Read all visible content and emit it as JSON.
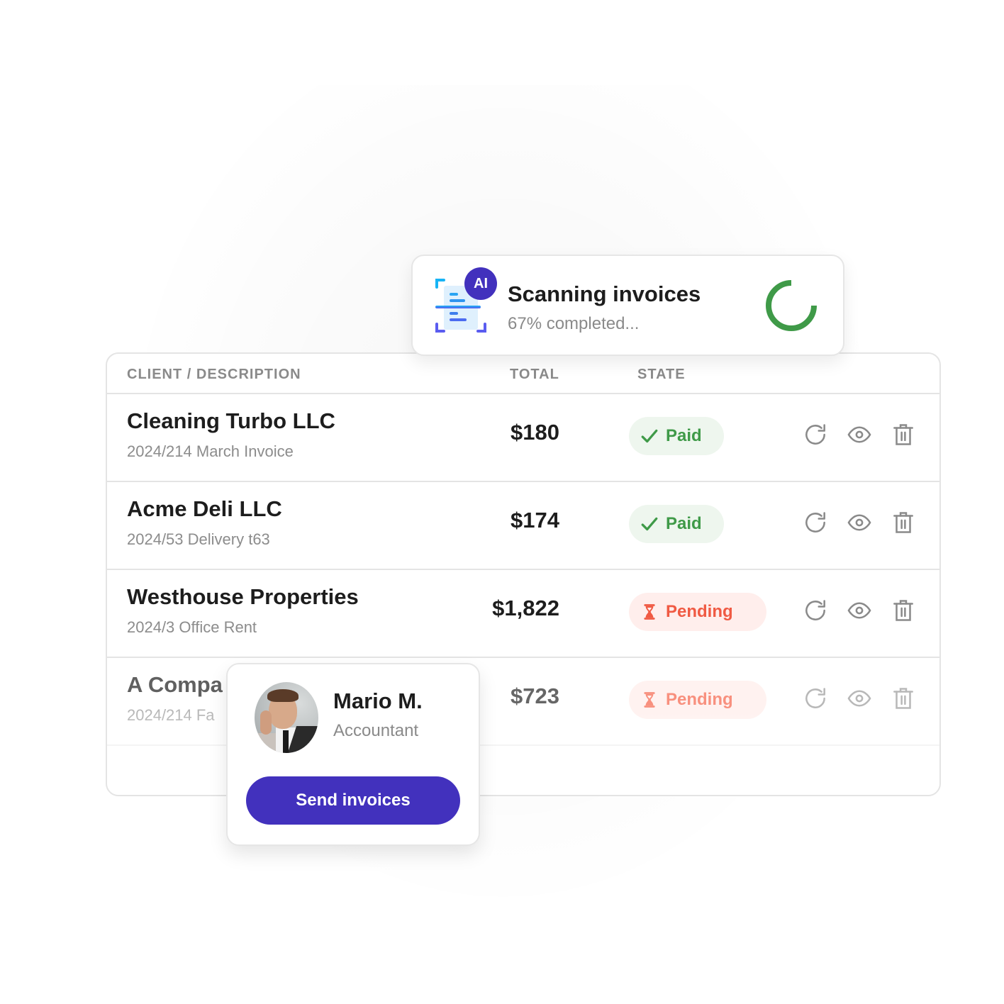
{
  "scan_toast": {
    "badge": "AI",
    "title": "Scanning invoices",
    "subtitle": "67% completed...",
    "progress_percent": 67,
    "ring_visible_fill": 0.75,
    "colors": {
      "ring": "#3f9a48",
      "badge": "#4231bd",
      "icon_top": "#17b4f5",
      "icon_bottom": "#5a5cf0"
    }
  },
  "table": {
    "headers": {
      "client": "CLIENT / DESCRIPTION",
      "total": "TOTAL",
      "state": "STATE"
    },
    "rows": [
      {
        "client": "Cleaning Turbo LLC",
        "description": "2024/214 March Invoice",
        "total": "$180",
        "state": "Paid",
        "state_icon": "check-icon"
      },
      {
        "client": "Acme Deli LLC",
        "description": "2024/53 Delivery t63",
        "total": "$174",
        "state": "Paid",
        "state_icon": "check-icon"
      },
      {
        "client": "Westhouse Properties",
        "description": "2024/3 Office Rent",
        "total": "$1,822",
        "state": "Pending",
        "state_icon": "hourglass-icon"
      },
      {
        "client": "A Compa",
        "description": "2024/214 Fa",
        "total": "$723",
        "state": "Pending",
        "state_icon": "hourglass-icon"
      }
    ],
    "row_actions": [
      "refresh-icon",
      "eye-icon",
      "trash-icon"
    ],
    "colors": {
      "paid_text": "#3f9a48",
      "paid_bg": "#eef6ee",
      "pending_text": "#f05a43",
      "pending_bg": "#ffeeec",
      "action_icon": "#8a8a8a"
    }
  },
  "person_card": {
    "name": "Mario M.",
    "role": "Accountant",
    "button_label": "Send invoices",
    "colors": {
      "button": "#4231bd"
    }
  }
}
